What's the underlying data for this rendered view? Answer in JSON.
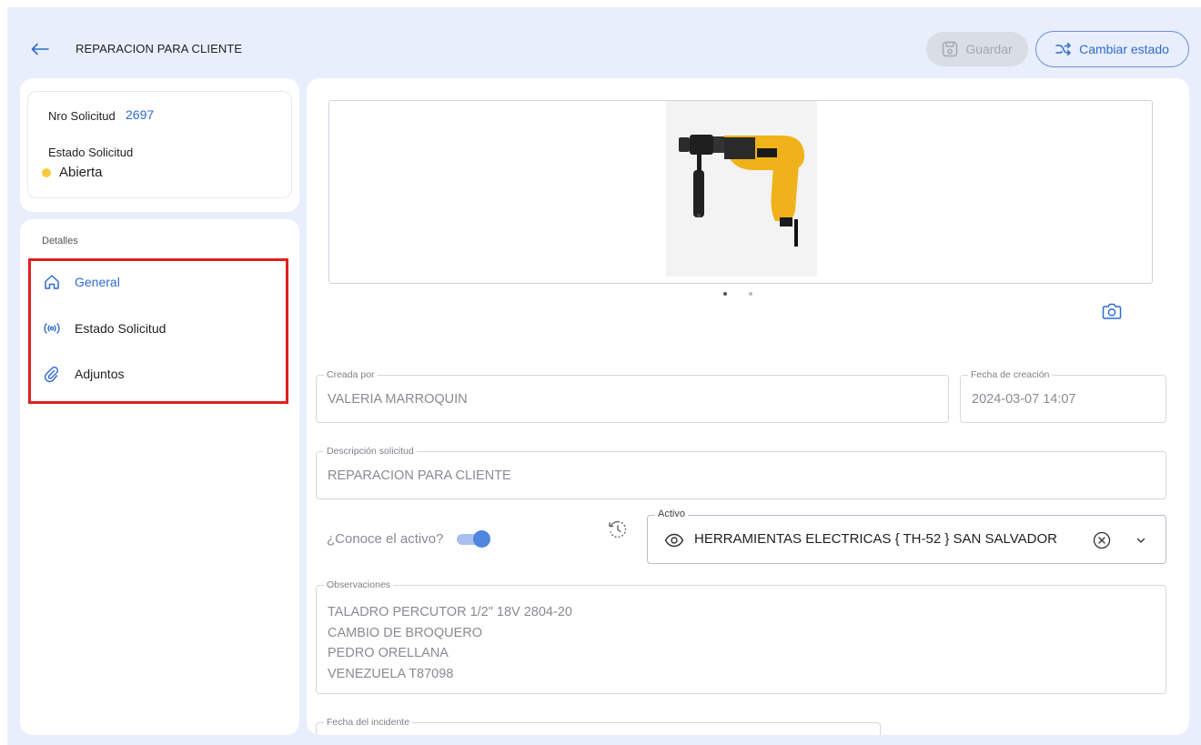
{
  "header": {
    "title": "REPARACION PARA CLIENTE",
    "save_label": "Guardar",
    "change_state_label": "Cambiar estado"
  },
  "summary": {
    "request_number_label": "Nro Solicitud",
    "request_number": "2697",
    "request_state_label": "Estado Solicitud",
    "request_state": "Abierta",
    "state_color": "#f5cd3b"
  },
  "nav": {
    "heading": "Detalles",
    "items": [
      {
        "label": "General",
        "icon": "home-icon",
        "active": true
      },
      {
        "label": "Estado Solicitud",
        "icon": "broadcast-icon",
        "active": false
      },
      {
        "label": "Adjuntos",
        "icon": "paperclip-icon",
        "active": false
      }
    ]
  },
  "form": {
    "created_by_label": "Creada por",
    "created_by": "VALERIA MARROQUIN",
    "created_date_label": "Fecha de creación",
    "created_date": "2024-03-07 14:07",
    "description_label": "Descripción solicitud",
    "description": "REPARACION PARA CLIENTE",
    "know_asset_label": "¿Conoce el activo?",
    "know_asset": true,
    "asset_label": "Activo",
    "asset": "HERRAMIENTAS ELECTRICAS { TH-52 } SAN SALVADOR",
    "observations_label": "Observaciones",
    "observations": [
      "TALADRO PERCUTOR 1/2\" 18V 2804-20",
      "CAMBIO DE BROQUERO",
      "PEDRO ORELLANA",
      "VENEZUELA T87098"
    ],
    "incident_date_label": "Fecha del incidente"
  },
  "carousel": {
    "count": 2,
    "current": 1
  },
  "colors": {
    "accent": "#2f6bd0",
    "background": "#e8eefb",
    "highlight_box": "#e02020"
  }
}
